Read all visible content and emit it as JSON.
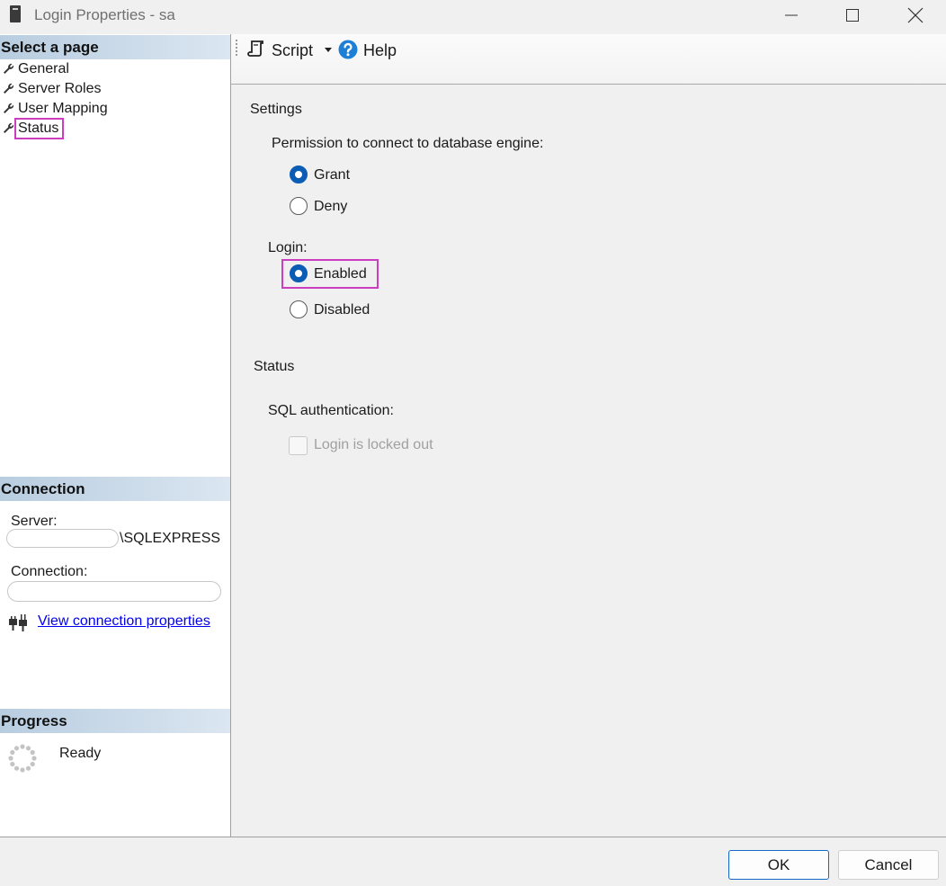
{
  "window": {
    "title": "Login Properties - sa",
    "controls": [
      "minimize-icon",
      "maximize-icon",
      "close-icon"
    ]
  },
  "left_pane": {
    "select_page": {
      "header": "Select a page",
      "items": [
        {
          "label": "General",
          "icon": "wrench-icon"
        },
        {
          "label": "Server Roles",
          "icon": "wrench-icon"
        },
        {
          "label": "User Mapping",
          "icon": "wrench-icon"
        },
        {
          "label": "Status",
          "icon": "wrench-icon",
          "selected": true
        }
      ]
    },
    "connection": {
      "header": "Connection",
      "server_label": "Server:",
      "server_value_suffix": "\\SQLEXPRESS",
      "connection_label": "Connection:",
      "link_text": "View connection properties"
    },
    "progress": {
      "header": "Progress",
      "status": "Ready"
    }
  },
  "toolbar": {
    "script_label": "Script",
    "help_label": "Help"
  },
  "settings": {
    "heading": "Settings",
    "permission_label": "Permission to connect to database engine:",
    "permission_options": [
      {
        "label": "Grant",
        "checked": true
      },
      {
        "label": "Deny",
        "checked": false
      }
    ],
    "login_label": "Login:",
    "login_options": [
      {
        "label": "Enabled",
        "checked": true
      },
      {
        "label": "Disabled",
        "checked": false
      }
    ]
  },
  "status": {
    "heading": "Status",
    "sql_auth_label": "SQL authentication:",
    "locked_out_label": "Login is locked out",
    "locked_out_checked": false,
    "locked_out_disabled": true
  },
  "buttons": {
    "ok": "OK",
    "cancel": "Cancel"
  },
  "colors": {
    "accent": "#0a5cb4",
    "highlight": "#cc3ec0",
    "link": "#0000ee",
    "disabled_text": "#a0a0a0"
  }
}
